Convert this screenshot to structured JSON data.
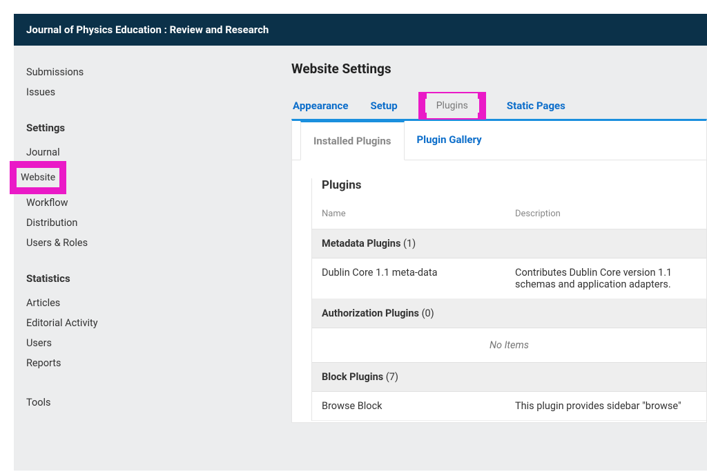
{
  "header": {
    "title": "Journal of Physics Education : Review and Research"
  },
  "sidebar": {
    "groups": [
      {
        "heading": null,
        "items": [
          {
            "label": "Submissions"
          },
          {
            "label": "Issues"
          }
        ]
      },
      {
        "heading": "Settings",
        "items": [
          {
            "label": "Journal"
          },
          {
            "label": "Website",
            "selected": true,
            "highlighted": true
          },
          {
            "label": "Workflow"
          },
          {
            "label": "Distribution"
          },
          {
            "label": "Users & Roles"
          }
        ]
      },
      {
        "heading": "Statistics",
        "items": [
          {
            "label": "Articles"
          },
          {
            "label": "Editorial Activity"
          },
          {
            "label": "Users"
          },
          {
            "label": "Reports"
          }
        ]
      },
      {
        "heading": null,
        "items": [
          {
            "label": "Tools"
          }
        ]
      }
    ]
  },
  "main": {
    "page_title": "Website Settings",
    "top_tabs": [
      {
        "label": "Appearance"
      },
      {
        "label": "Setup"
      },
      {
        "label": "Plugins",
        "active": true,
        "highlighted": true
      },
      {
        "label": "Static Pages"
      }
    ],
    "sub_tabs": [
      {
        "label": "Installed Plugins",
        "active": true
      },
      {
        "label": "Plugin Gallery"
      }
    ],
    "plugins": {
      "title": "Plugins",
      "columns": {
        "name": "Name",
        "desc": "Description"
      },
      "no_items_label": "No Items",
      "groups": [
        {
          "title": "Metadata Plugins",
          "count": "(1)",
          "rows": [
            {
              "name": "Dublin Core 1.1 meta-data",
              "desc": "Contributes Dublin Core version 1.1 schemas and application adapters."
            }
          ]
        },
        {
          "title": "Authorization Plugins",
          "count": "(0)",
          "rows": []
        },
        {
          "title": "Block Plugins",
          "count": "(7)",
          "rows": [
            {
              "name": "Browse Block",
              "desc": "This plugin provides sidebar \"browse\""
            }
          ]
        }
      ]
    }
  }
}
